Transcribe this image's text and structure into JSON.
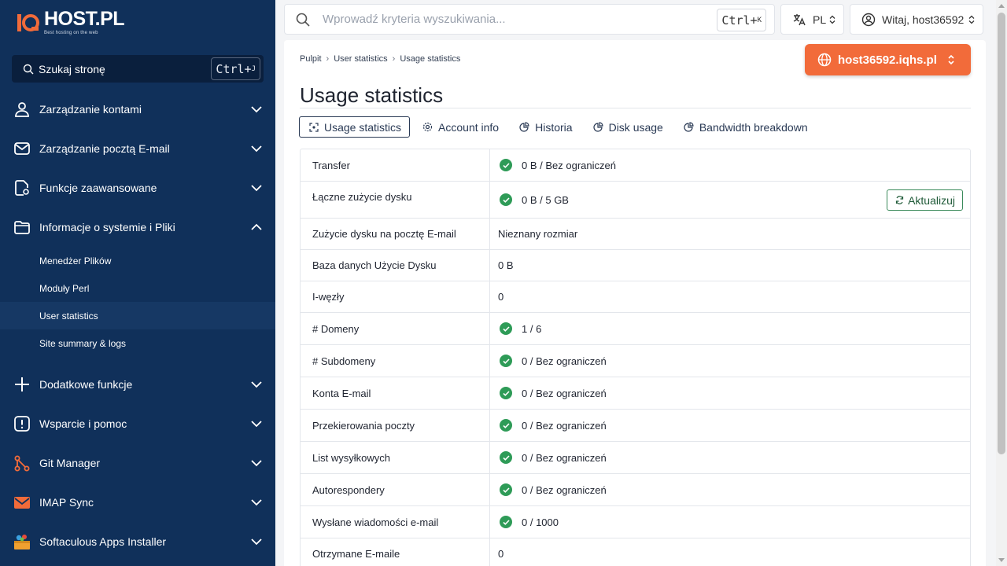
{
  "brand": {
    "name": "HOST.PL",
    "tagline": "Best hosting on the web",
    "accent": "#f26b3a",
    "sidebar_bg": "#10305a"
  },
  "sidebar": {
    "search": {
      "label": "Szukaj stronę",
      "shortcut_key": "Ctrl+",
      "shortcut_letter": "J"
    },
    "items": [
      {
        "label": "Zarządzanie kontami",
        "icon": "user-icon",
        "expanded": false
      },
      {
        "label": "Zarządzanie pocztą E-mail",
        "icon": "mail-icon",
        "expanded": false
      },
      {
        "label": "Funkcje zaawansowane",
        "icon": "doc-settings-icon",
        "expanded": false
      },
      {
        "label": "Informacje o systemie i Pliki",
        "icon": "folder-icon",
        "expanded": true
      },
      {
        "label": "Dodatkowe funkcje",
        "icon": "plus-icon",
        "expanded": false
      },
      {
        "label": "Wsparcie i pomoc",
        "icon": "alert-icon",
        "expanded": false
      },
      {
        "label": "Git Manager",
        "icon": "git-icon",
        "expanded": false
      },
      {
        "label": "IMAP Sync",
        "icon": "imap-icon",
        "expanded": false
      },
      {
        "label": "Softaculous Apps Installer",
        "icon": "softaculous-icon",
        "expanded": false
      }
    ],
    "subitems": [
      {
        "label": "Menedżer Plików",
        "active": false
      },
      {
        "label": "Moduły Perl",
        "active": false
      },
      {
        "label": "User statistics",
        "active": true
      },
      {
        "label": "Site summary & logs",
        "active": false
      }
    ]
  },
  "topbar": {
    "search_placeholder": "Wprowadź kryteria wyszukiwania...",
    "search_shortcut_key": "Ctrl+",
    "search_shortcut_letter": "K",
    "language": "PL",
    "greeting": "Witaj, host36592"
  },
  "breadcrumb": [
    "Pulpit",
    "User statistics",
    "Usage statistics"
  ],
  "domain": "host36592.iqhs.pl",
  "page_title": "Usage statistics",
  "tabs": [
    {
      "label": "Usage statistics",
      "active": true
    },
    {
      "label": "Account info",
      "active": false
    },
    {
      "label": "Historia",
      "active": false
    },
    {
      "label": "Disk usage",
      "active": false
    },
    {
      "label": "Bandwidth breakdown",
      "active": false
    }
  ],
  "refresh_label": "Aktualizuj",
  "stats": [
    {
      "key": "Transfer",
      "value": "0 B / Bez ograniczeń",
      "ok": true
    },
    {
      "key": "Łączne zużycie dysku",
      "value": "0 B / 5 GB",
      "ok": true
    },
    {
      "key": "Zużycie dysku na pocztę E-mail",
      "value": "Nieznany rozmiar",
      "ok": false
    },
    {
      "key": "Baza danych Użycie Dysku",
      "value": "0 B",
      "ok": false
    },
    {
      "key": "I-węzły",
      "value": "0",
      "ok": false
    },
    {
      "key": "# Domeny",
      "value": "1 / 6",
      "ok": true
    },
    {
      "key": "# Subdomeny",
      "value": "0 / Bez ograniczeń",
      "ok": true
    },
    {
      "key": "Konta E-mail",
      "value": "0 / Bez ograniczeń",
      "ok": true
    },
    {
      "key": "Przekierowania poczty",
      "value": "0 / Bez ograniczeń",
      "ok": true
    },
    {
      "key": "List wysyłkowych",
      "value": "0 / Bez ograniczeń",
      "ok": true
    },
    {
      "key": "Autorespondery",
      "value": "0 / Bez ograniczeń",
      "ok": true
    },
    {
      "key": "Wysłane wiadomości e-mail",
      "value": "0 / 1000",
      "ok": true
    },
    {
      "key": "Otrzymane E-maile",
      "value": "0",
      "ok": false
    }
  ]
}
